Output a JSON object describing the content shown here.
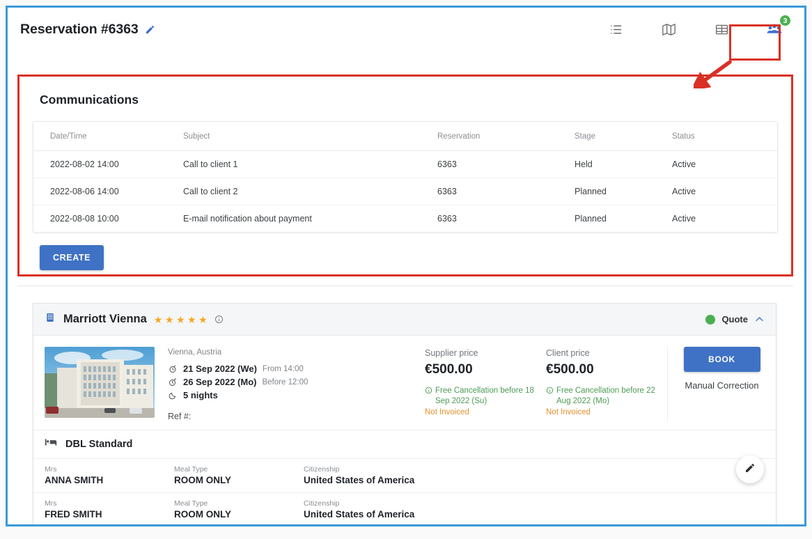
{
  "header": {
    "title": "Reservation #6363",
    "edit_icon": "pencil-icon",
    "actions": [
      {
        "icon": "list-icon",
        "name": "list-view-button"
      },
      {
        "icon": "map-icon",
        "name": "map-view-button"
      },
      {
        "icon": "table-icon",
        "name": "table-view-button"
      },
      {
        "icon": "people-group-icon",
        "name": "communications-button",
        "badge": "3"
      }
    ]
  },
  "communications": {
    "title": "Communications",
    "columns": [
      "Date/Time",
      "Subject",
      "Reservation",
      "Stage",
      "Status"
    ],
    "rows": [
      {
        "datetime": "2022-08-02 14:00",
        "subject": "Call to client 1",
        "reservation": "6363",
        "stage": "Held",
        "status": "Active"
      },
      {
        "datetime": "2022-08-06 14:00",
        "subject": "Call to client 2",
        "reservation": "6363",
        "stage": "Planned",
        "status": "Active"
      },
      {
        "datetime": "2022-08-08 10:00",
        "subject": "E-mail notification about payment",
        "reservation": "6363",
        "stage": "Planned",
        "status": "Active"
      }
    ],
    "create_label": "CREATE"
  },
  "hotel": {
    "name": "Marriott Vienna",
    "star_rating": 5,
    "star_glyph": "★",
    "info_icon": "info-icon",
    "status_label": "Quote",
    "status_color": "#4caf50",
    "collapse_icon": "chevron-up-icon",
    "location": "Vienna, Austria",
    "checkin": {
      "date": "21 Sep 2022 (We)",
      "time": "From 14:00",
      "icon": "check-in-clock-icon"
    },
    "checkout": {
      "date": "26 Sep 2022 (Mo)",
      "time": "Before 12:00",
      "icon": "check-out-clock-icon"
    },
    "nights": {
      "text": "5 nights",
      "icon": "moon-icon"
    },
    "ref_label": "Ref #:",
    "supplier": {
      "label": "Supplier price",
      "value": "€500.00",
      "cancellation": "Free Cancellation before 18 Sep 2022 (Su)",
      "invoice_status": "Not Invoiced"
    },
    "client": {
      "label": "Client price",
      "value": "€500.00",
      "cancellation": "Free Cancellation before 22 Aug 2022 (Mo)",
      "invoice_status": "Not Invoiced"
    },
    "book_label": "BOOK",
    "manual_correction": "Manual Correction",
    "room": {
      "name": "DBL Standard",
      "icon": "bed-icon"
    },
    "guests": [
      {
        "title": "Mrs",
        "name": "ANNA SMITH",
        "meal_label": "Meal Type",
        "meal": "ROOM ONLY",
        "citizenship_label": "Citizenship",
        "citizenship": "United States of America"
      },
      {
        "title": "Mrs",
        "name": "FRED SMITH",
        "meal_label": "Meal Type",
        "meal": "ROOM ONLY",
        "citizenship_label": "Citizenship",
        "citizenship": "United States of America"
      }
    ]
  },
  "fab": {
    "icon": "pencil-icon",
    "name": "edit-floating-button"
  },
  "annotations": {
    "highlight_color": "#d93025",
    "frame_color": "#3a9ad9"
  }
}
